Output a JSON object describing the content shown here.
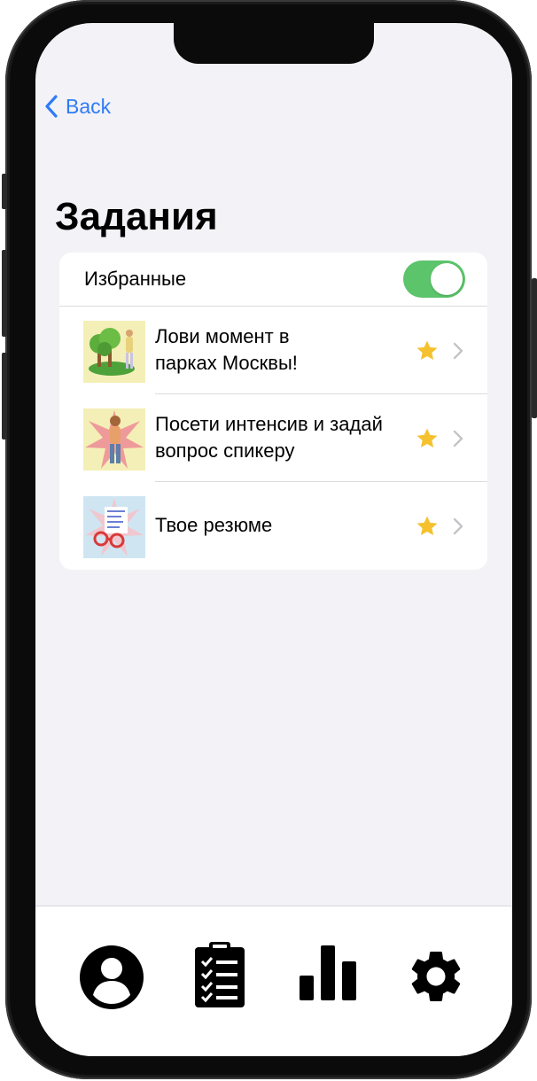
{
  "nav": {
    "back_label": "Back"
  },
  "page": {
    "title": "Задания"
  },
  "favorites": {
    "label": "Избранные",
    "enabled": true,
    "accent": "#5cc46b"
  },
  "tasks": [
    {
      "line1": "Лови момент в",
      "line2": "парках Москвы!",
      "favorite": true
    },
    {
      "line1": "Посети интенсив и задай",
      "line2": "вопрос спикеру",
      "favorite": true
    },
    {
      "line1": "Твое резюме",
      "line2": "",
      "favorite": true
    }
  ],
  "colors": {
    "link": "#2f7bf5",
    "star": "#f5c12e",
    "background": "#f2f2f7"
  },
  "tabbar": {
    "items": [
      {
        "icon": "person-circle-icon"
      },
      {
        "icon": "clipboard-checklist-icon"
      },
      {
        "icon": "bar-chart-icon"
      },
      {
        "icon": "gear-icon"
      }
    ]
  }
}
